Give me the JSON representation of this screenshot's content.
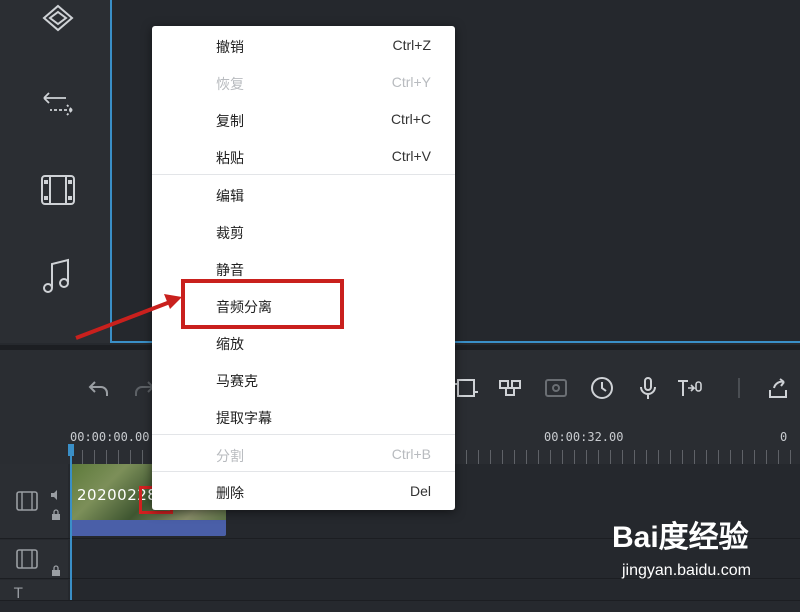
{
  "context_menu": {
    "items": [
      {
        "label": "撤销",
        "shortcut": "Ctrl+Z",
        "enabled": true
      },
      {
        "label": "恢复",
        "shortcut": "Ctrl+Y",
        "enabled": false
      },
      {
        "label": "复制",
        "shortcut": "Ctrl+C",
        "enabled": true
      },
      {
        "label": "粘贴",
        "shortcut": "Ctrl+V",
        "enabled": true
      },
      {
        "label": "编辑",
        "shortcut": "",
        "enabled": true
      },
      {
        "label": "裁剪",
        "shortcut": "",
        "enabled": true
      },
      {
        "label": "静音",
        "shortcut": "",
        "enabled": true
      },
      {
        "label": "音频分离",
        "shortcut": "",
        "enabled": true,
        "highlighted": true
      },
      {
        "label": "缩放",
        "shortcut": "",
        "enabled": true
      },
      {
        "label": "马赛克",
        "shortcut": "",
        "enabled": true
      },
      {
        "label": "提取字幕",
        "shortcut": "",
        "enabled": true
      },
      {
        "label": "分割",
        "shortcut": "Ctrl+B",
        "enabled": false
      },
      {
        "label": "删除",
        "shortcut": "Del",
        "enabled": true
      }
    ]
  },
  "timeline": {
    "time_start": "00:00:00.00",
    "time_mid": "00:00:32.00",
    "time_end_partial": "0"
  },
  "clip": {
    "name": "20200228"
  },
  "sidebar": {
    "icons": [
      "layers-icon",
      "transition-icon",
      "filmstrip-icon",
      "music-icon"
    ]
  },
  "toolbar": {
    "icons": [
      "undo-icon",
      "redo-icon",
      "crop-icon",
      "mosaic-icon",
      "freeze-frame-icon",
      "speed-icon",
      "voiceover-icon",
      "text-to-speech-icon",
      "export-icon"
    ]
  },
  "watermark": {
    "brand": "Bai度经验",
    "url": "jingyan.baidu.com"
  },
  "colors": {
    "accent": "#3a8fc7",
    "highlight": "#c9201d",
    "clip_audio_bar": "#4a5fa8"
  }
}
